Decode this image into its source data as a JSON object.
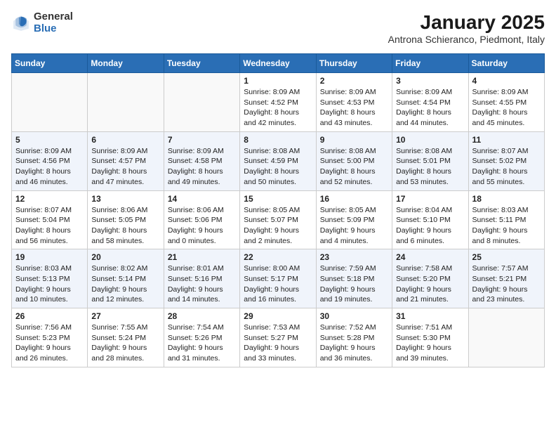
{
  "logo": {
    "general": "General",
    "blue": "Blue"
  },
  "header": {
    "month": "January 2025",
    "location": "Antrona Schieranco, Piedmont, Italy"
  },
  "weekdays": [
    "Sunday",
    "Monday",
    "Tuesday",
    "Wednesday",
    "Thursday",
    "Friday",
    "Saturday"
  ],
  "weeks": [
    [
      {
        "day": "",
        "info": ""
      },
      {
        "day": "",
        "info": ""
      },
      {
        "day": "",
        "info": ""
      },
      {
        "day": "1",
        "info": "Sunrise: 8:09 AM\nSunset: 4:52 PM\nDaylight: 8 hours and 42 minutes."
      },
      {
        "day": "2",
        "info": "Sunrise: 8:09 AM\nSunset: 4:53 PM\nDaylight: 8 hours and 43 minutes."
      },
      {
        "day": "3",
        "info": "Sunrise: 8:09 AM\nSunset: 4:54 PM\nDaylight: 8 hours and 44 minutes."
      },
      {
        "day": "4",
        "info": "Sunrise: 8:09 AM\nSunset: 4:55 PM\nDaylight: 8 hours and 45 minutes."
      }
    ],
    [
      {
        "day": "5",
        "info": "Sunrise: 8:09 AM\nSunset: 4:56 PM\nDaylight: 8 hours and 46 minutes."
      },
      {
        "day": "6",
        "info": "Sunrise: 8:09 AM\nSunset: 4:57 PM\nDaylight: 8 hours and 47 minutes."
      },
      {
        "day": "7",
        "info": "Sunrise: 8:09 AM\nSunset: 4:58 PM\nDaylight: 8 hours and 49 minutes."
      },
      {
        "day": "8",
        "info": "Sunrise: 8:08 AM\nSunset: 4:59 PM\nDaylight: 8 hours and 50 minutes."
      },
      {
        "day": "9",
        "info": "Sunrise: 8:08 AM\nSunset: 5:00 PM\nDaylight: 8 hours and 52 minutes."
      },
      {
        "day": "10",
        "info": "Sunrise: 8:08 AM\nSunset: 5:01 PM\nDaylight: 8 hours and 53 minutes."
      },
      {
        "day": "11",
        "info": "Sunrise: 8:07 AM\nSunset: 5:02 PM\nDaylight: 8 hours and 55 minutes."
      }
    ],
    [
      {
        "day": "12",
        "info": "Sunrise: 8:07 AM\nSunset: 5:04 PM\nDaylight: 8 hours and 56 minutes."
      },
      {
        "day": "13",
        "info": "Sunrise: 8:06 AM\nSunset: 5:05 PM\nDaylight: 8 hours and 58 minutes."
      },
      {
        "day": "14",
        "info": "Sunrise: 8:06 AM\nSunset: 5:06 PM\nDaylight: 9 hours and 0 minutes."
      },
      {
        "day": "15",
        "info": "Sunrise: 8:05 AM\nSunset: 5:07 PM\nDaylight: 9 hours and 2 minutes."
      },
      {
        "day": "16",
        "info": "Sunrise: 8:05 AM\nSunset: 5:09 PM\nDaylight: 9 hours and 4 minutes."
      },
      {
        "day": "17",
        "info": "Sunrise: 8:04 AM\nSunset: 5:10 PM\nDaylight: 9 hours and 6 minutes."
      },
      {
        "day": "18",
        "info": "Sunrise: 8:03 AM\nSunset: 5:11 PM\nDaylight: 9 hours and 8 minutes."
      }
    ],
    [
      {
        "day": "19",
        "info": "Sunrise: 8:03 AM\nSunset: 5:13 PM\nDaylight: 9 hours and 10 minutes."
      },
      {
        "day": "20",
        "info": "Sunrise: 8:02 AM\nSunset: 5:14 PM\nDaylight: 9 hours and 12 minutes."
      },
      {
        "day": "21",
        "info": "Sunrise: 8:01 AM\nSunset: 5:16 PM\nDaylight: 9 hours and 14 minutes."
      },
      {
        "day": "22",
        "info": "Sunrise: 8:00 AM\nSunset: 5:17 PM\nDaylight: 9 hours and 16 minutes."
      },
      {
        "day": "23",
        "info": "Sunrise: 7:59 AM\nSunset: 5:18 PM\nDaylight: 9 hours and 19 minutes."
      },
      {
        "day": "24",
        "info": "Sunrise: 7:58 AM\nSunset: 5:20 PM\nDaylight: 9 hours and 21 minutes."
      },
      {
        "day": "25",
        "info": "Sunrise: 7:57 AM\nSunset: 5:21 PM\nDaylight: 9 hours and 23 minutes."
      }
    ],
    [
      {
        "day": "26",
        "info": "Sunrise: 7:56 AM\nSunset: 5:23 PM\nDaylight: 9 hours and 26 minutes."
      },
      {
        "day": "27",
        "info": "Sunrise: 7:55 AM\nSunset: 5:24 PM\nDaylight: 9 hours and 28 minutes."
      },
      {
        "day": "28",
        "info": "Sunrise: 7:54 AM\nSunset: 5:26 PM\nDaylight: 9 hours and 31 minutes."
      },
      {
        "day": "29",
        "info": "Sunrise: 7:53 AM\nSunset: 5:27 PM\nDaylight: 9 hours and 33 minutes."
      },
      {
        "day": "30",
        "info": "Sunrise: 7:52 AM\nSunset: 5:28 PM\nDaylight: 9 hours and 36 minutes."
      },
      {
        "day": "31",
        "info": "Sunrise: 7:51 AM\nSunset: 5:30 PM\nDaylight: 9 hours and 39 minutes."
      },
      {
        "day": "",
        "info": ""
      }
    ]
  ]
}
